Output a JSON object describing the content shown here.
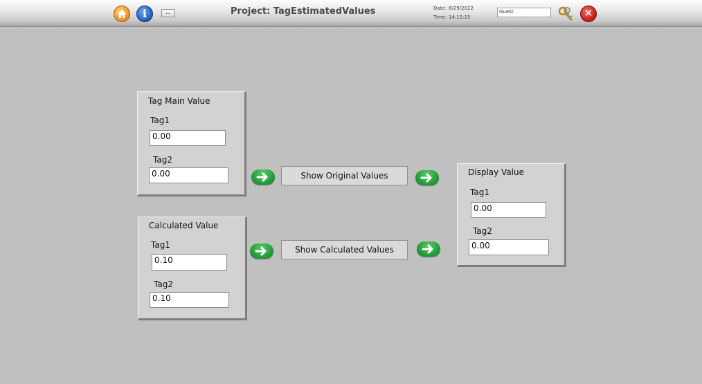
{
  "header": {
    "title": "Project: TagEstimatedValues",
    "more_label": "...",
    "date_label": "Date:",
    "date_value": "8/29/2022",
    "time_label": "Time:",
    "time_value": "14:15:15",
    "user_value": "Guest",
    "icons": [
      "home-icon",
      "info-icon",
      "key-icon",
      "close-icon"
    ]
  },
  "main_panel": {
    "title": "Tag Main Value",
    "tag1_label": "Tag1",
    "tag1_value": "0.00",
    "tag2_label": "Tag2",
    "tag2_value": "0.00"
  },
  "calc_panel": {
    "title": "Calculated Value",
    "tag1_label": "Tag1",
    "tag1_value": "0.10",
    "tag2_label": "Tag2",
    "tag2_value": "0.10"
  },
  "display_panel": {
    "title": "Display Value",
    "tag1_label": "Tag1",
    "tag1_value": "0.00",
    "tag2_label": "Tag2",
    "tag2_value": "0.00"
  },
  "buttons": {
    "show_original": "Show Original Values",
    "show_calculated": "Show Calculated Values"
  },
  "colors": {
    "background": "#c0c0c0",
    "panel": "#d2d2d2",
    "arrow_green": "#2aa23f"
  }
}
